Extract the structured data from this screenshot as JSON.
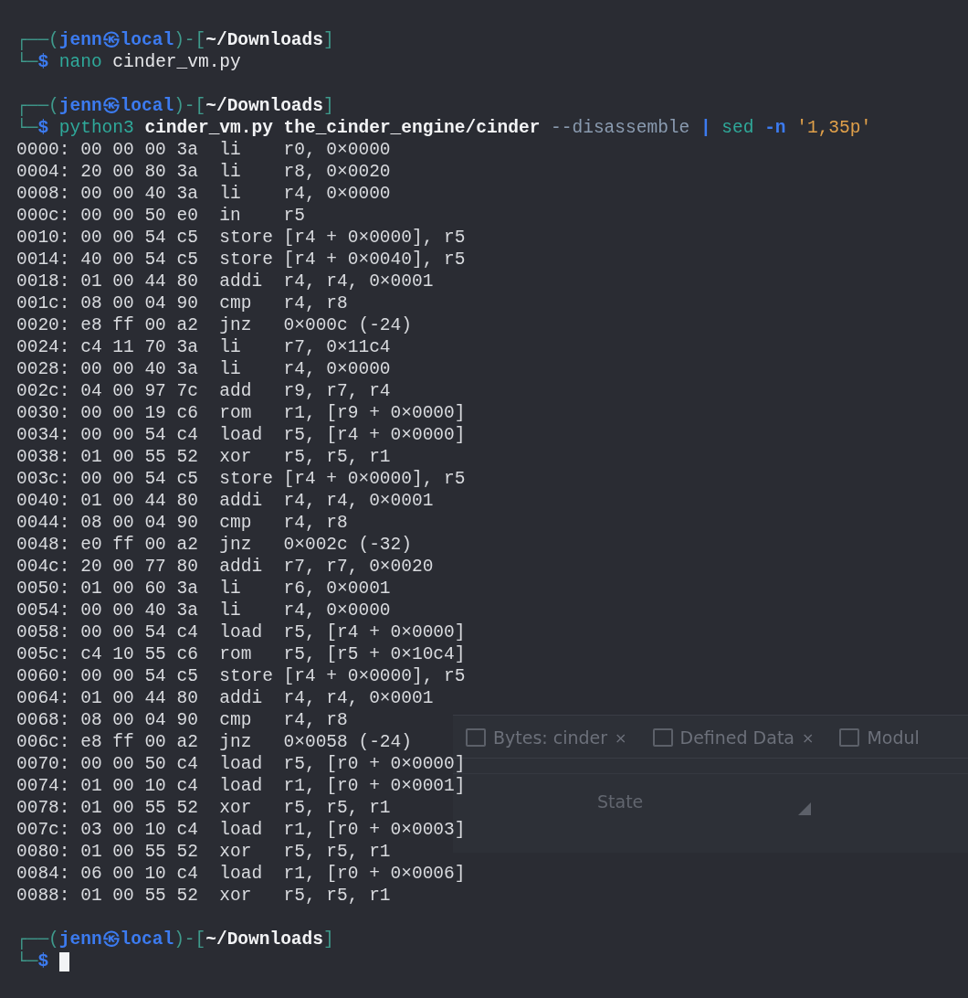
{
  "background_window": {
    "tabs": [
      {
        "label": "Bytes: cinder",
        "close": "×"
      },
      {
        "label": "Defined Data",
        "close": "×"
      },
      {
        "label": "Modul"
      }
    ],
    "columns": [
      "State"
    ]
  },
  "terminal": {
    "blocks": [
      {
        "kind": "prompt",
        "header": [
          {
            "text": "┌──(",
            "kind": "frame"
          },
          {
            "text": "jenn㉿local",
            "kind": "host"
          },
          {
            "text": ")-[",
            "kind": "frame"
          },
          {
            "text": "~/Downloads",
            "kind": "path"
          },
          {
            "text": "]",
            "kind": "frame"
          }
        ],
        "command": [
          {
            "text": "└─",
            "kind": "frame"
          },
          {
            "text": "$ ",
            "kind": "sigil"
          },
          {
            "text": "nano",
            "kind": "program"
          },
          {
            "text": " cinder_vm.py",
            "kind": "plain"
          }
        ],
        "cursor": false
      },
      {
        "kind": "prompt",
        "header": [
          {
            "text": "┌──(",
            "kind": "frame"
          },
          {
            "text": "jenn㉿local",
            "kind": "host"
          },
          {
            "text": ")-[",
            "kind": "frame"
          },
          {
            "text": "~/Downloads",
            "kind": "path"
          },
          {
            "text": "]",
            "kind": "frame"
          }
        ],
        "command": [
          {
            "text": "└─",
            "kind": "frame"
          },
          {
            "text": "$ ",
            "kind": "sigil"
          },
          {
            "text": "python3",
            "kind": "program"
          },
          {
            "text": " cinder_vm.py the_cinder_engine/cinder ",
            "kind": "bold"
          },
          {
            "text": "--disassemble",
            "kind": "option"
          },
          {
            "text": " | ",
            "kind": "sigil"
          },
          {
            "text": "sed",
            "kind": "program"
          },
          {
            "text": " -n ",
            "kind": "sigil"
          },
          {
            "text": "'1,35p'",
            "kind": "string"
          }
        ],
        "cursor": false
      },
      {
        "kind": "output",
        "lines": [
          "0000: 00 00 00 3a  li    r0, 0×0000",
          "0004: 20 00 80 3a  li    r8, 0×0020",
          "0008: 00 00 40 3a  li    r4, 0×0000",
          "000c: 00 00 50 e0  in    r5",
          "0010: 00 00 54 c5  store [r4 + 0×0000], r5",
          "0014: 40 00 54 c5  store [r4 + 0×0040], r5",
          "0018: 01 00 44 80  addi  r4, r4, 0×0001",
          "001c: 08 00 04 90  cmp   r4, r8",
          "0020: e8 ff 00 a2  jnz   0×000c (-24)",
          "0024: c4 11 70 3a  li    r7, 0×11c4",
          "0028: 00 00 40 3a  li    r4, 0×0000",
          "002c: 04 00 97 7c  add   r9, r7, r4",
          "0030: 00 00 19 c6  rom   r1, [r9 + 0×0000]",
          "0034: 00 00 54 c4  load  r5, [r4 + 0×0000]",
          "0038: 01 00 55 52  xor   r5, r5, r1",
          "003c: 00 00 54 c5  store [r4 + 0×0000], r5",
          "0040: 01 00 44 80  addi  r4, r4, 0×0001",
          "0044: 08 00 04 90  cmp   r4, r8",
          "0048: e0 ff 00 a2  jnz   0×002c (-32)",
          "004c: 20 00 77 80  addi  r7, r7, 0×0020",
          "0050: 01 00 60 3a  li    r6, 0×0001",
          "0054: 00 00 40 3a  li    r4, 0×0000",
          "0058: 00 00 54 c4  load  r5, [r4 + 0×0000]",
          "005c: c4 10 55 c6  rom   r5, [r5 + 0×10c4]",
          "0060: 00 00 54 c5  store [r4 + 0×0000], r5",
          "0064: 01 00 44 80  addi  r4, r4, 0×0001",
          "0068: 08 00 04 90  cmp   r4, r8",
          "006c: e8 ff 00 a2  jnz   0×0058 (-24)",
          "0070: 00 00 50 c4  load  r5, [r0 + 0×0000]",
          "0074: 01 00 10 c4  load  r1, [r0 + 0×0001]",
          "0078: 01 00 55 52  xor   r5, r5, r1",
          "007c: 03 00 10 c4  load  r1, [r0 + 0×0003]",
          "0080: 01 00 55 52  xor   r5, r5, r1",
          "0084: 06 00 10 c4  load  r1, [r0 + 0×0006]",
          "0088: 01 00 55 52  xor   r5, r5, r1"
        ]
      },
      {
        "kind": "prompt",
        "header": [
          {
            "text": "┌──(",
            "kind": "frame"
          },
          {
            "text": "jenn㉿local",
            "kind": "host"
          },
          {
            "text": ")-[",
            "kind": "frame"
          },
          {
            "text": "~/Downloads",
            "kind": "path"
          },
          {
            "text": "]",
            "kind": "frame"
          }
        ],
        "command": [
          {
            "text": "└─",
            "kind": "frame"
          },
          {
            "text": "$ ",
            "kind": "sigil"
          }
        ],
        "cursor": true
      }
    ]
  }
}
